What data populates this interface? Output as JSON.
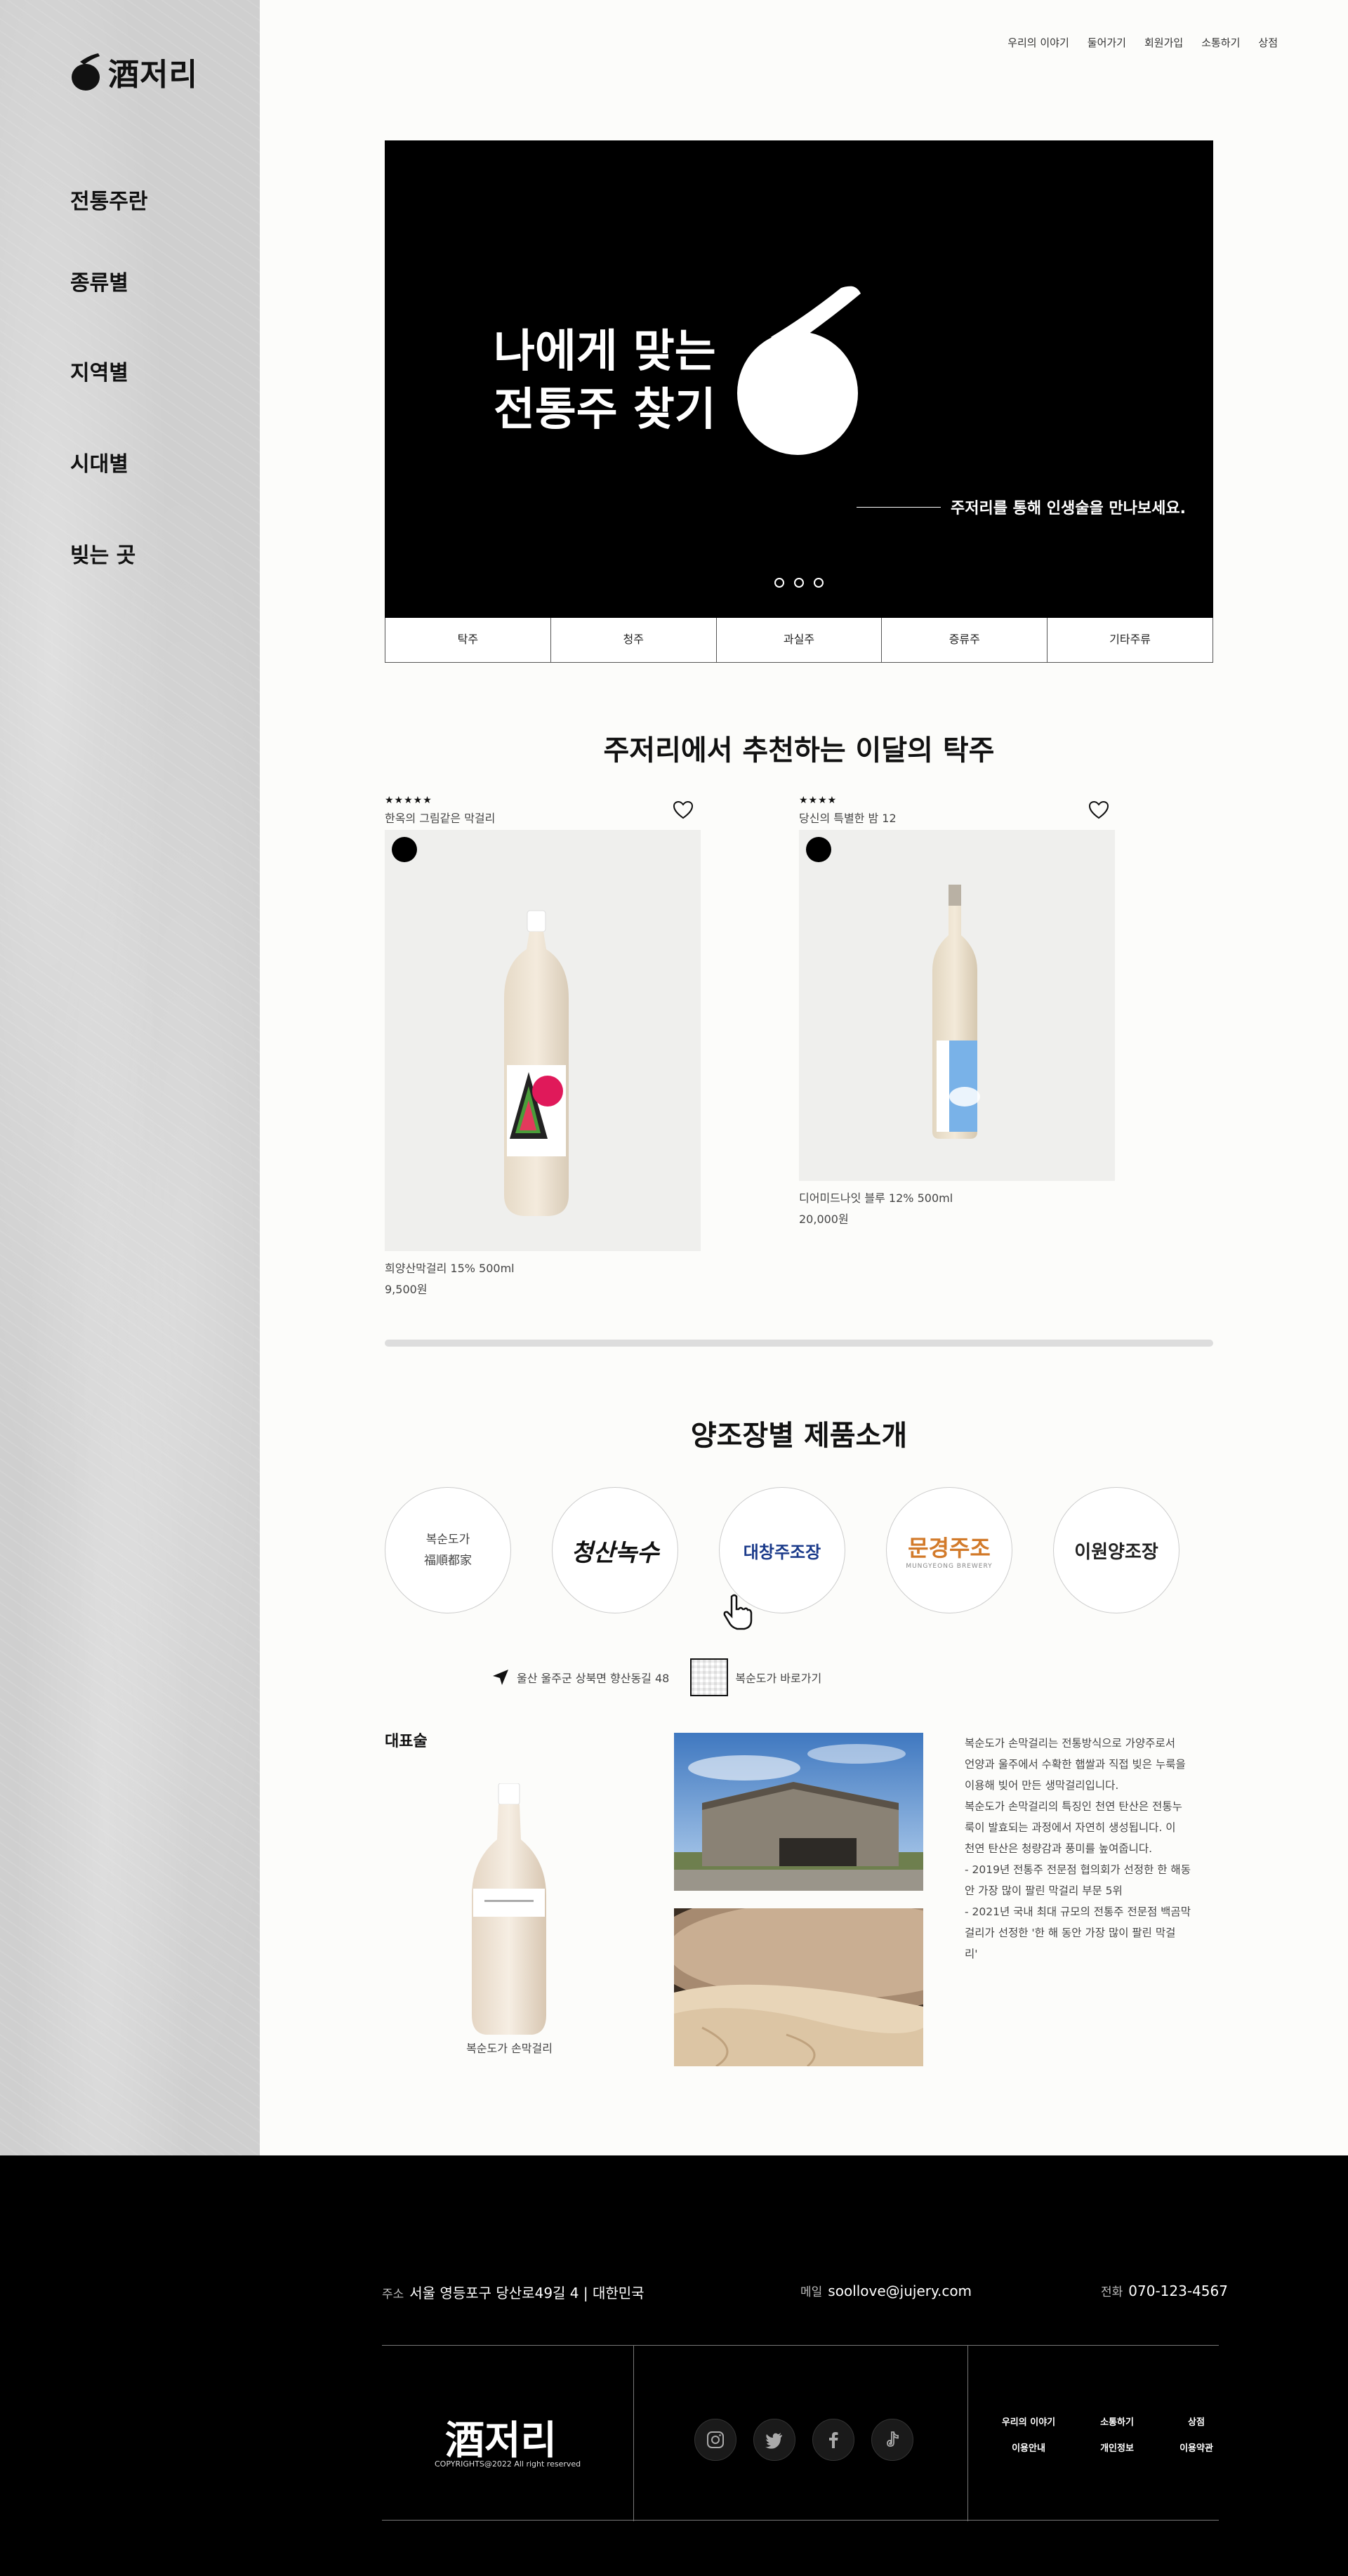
{
  "brand": {
    "logo_text": "酒저리"
  },
  "side_nav": [
    "전통주란",
    "종류별",
    "지역별",
    "시대별",
    "빚는 곳"
  ],
  "top_nav": [
    "우리의 이야기",
    "둘어가기",
    "회원가입",
    "소통하기",
    "상점"
  ],
  "hero": {
    "title_line1": "나에게 맞는",
    "title_line2": "전통주 찾기",
    "subtitle": "주저리를 통해 인생술을 만나보세요."
  },
  "categories": [
    "탁주",
    "청주",
    "과실주",
    "증류주",
    "기타주류"
  ],
  "recommend": {
    "title": "주저리에서 추천하는 이달의 탁주",
    "products": [
      {
        "stars": "★★★★★",
        "tagline": "한옥의 그림같은 막걸리",
        "name": "희양산막걸리 15% 500ml",
        "price": "9,500원"
      },
      {
        "stars": "★★★★",
        "tagline": "당신의 특별한 밤 12",
        "name": "디어미드나잇 블루 12% 500ml",
        "price": "20,000원"
      }
    ]
  },
  "brewery": {
    "title": "양조장별 제품소개",
    "items": [
      {
        "line1": "복순도가",
        "line2": "福順都家"
      },
      {
        "line1": "청산녹수",
        "line2": ""
      },
      {
        "line1": "대창주조장",
        "line2": ""
      },
      {
        "line1": "문경주조",
        "line2": "MUNGYEONG BREWERY"
      },
      {
        "line1": "이원양조장",
        "line2": ""
      }
    ],
    "address": "울산 울주군 상북면 향산동길 48",
    "shortcut": "복순도가 바로가기",
    "rep_label": "대표술",
    "rep_name": "복순도가 손막걸리",
    "description": [
      "복순도가 손막걸리는 전통방식으로 가양주로서",
      "언양과 울주에서 수확한 햅쌀과 직접 빚은 누룩을",
      "이용해 빚어 만든 생막걸리입니다.",
      "복순도가 손막걸리의 특징인 천연 탄산은 전통누",
      "룩이 발효되는 과정에서 자연히 생성됩니다. 이",
      "천연 탄산은 청량감과 풍미를 높여줍니다.",
      "- 2019년 전통주 전문점 협의회가 선정한 한 해동",
      "안 가장 많이 팔린 막걸리 부문 5위",
      "- 2021년 국내 최대 규모의 전통주 전문점 백곰막",
      "걸리가 선정한 '한 해 동안 가장 많이 팔린 막걸",
      "리'"
    ]
  },
  "footer": {
    "address_label": "주소",
    "address": "서울 영등포구 당산로49길 4 | 대한민국",
    "email_label": "메일",
    "email": "soollove@jujery.com",
    "phone_label": "전화",
    "phone": "070-123-4567",
    "logo_text": "酒저리",
    "copyright": "COPYRIGHTS@2022 All right reserved",
    "links": [
      "우리의 이야기",
      "소통하기",
      "상점",
      "이용안내",
      "개인정보",
      "이용약관"
    ]
  },
  "colors": {
    "hero_bg": "#000000",
    "footer_bg": "#000000",
    "sidebar_bg": "#cfcfcf"
  }
}
